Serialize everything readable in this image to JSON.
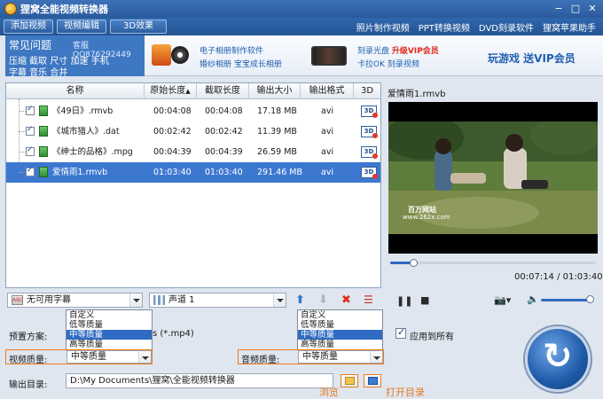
{
  "app": {
    "title": "狸窝全能视频转换器",
    "window_buttons": [
      "−",
      "□",
      "✕"
    ]
  },
  "toolbar": {
    "add_video": "添加视频",
    "edit_video": "视频编辑",
    "effect_3d": "3D效果",
    "links": [
      "照片制作视频",
      "PPT转换视频",
      "DVD刻录软件",
      "狸窝苹果助手"
    ]
  },
  "faq": {
    "heading": "常见问题",
    "qq": "客服QQ876292449",
    "row1": "压缩  截取  尺寸  加速  手机",
    "row2": "字幕  音乐  合并"
  },
  "promo": {
    "album_line1": "电子相册制作软件",
    "album_line2": "婚纱相册  宝宝成长相册",
    "burn_line1": "刻录光盘",
    "burn_vip": "升级VIP会员",
    "burn_line2": "卡拉OK  刻录视频",
    "game": "玩游戏  送VIP会员"
  },
  "table": {
    "headers": [
      "名称",
      "原始长度",
      "截取长度",
      "输出大小",
      "输出格式",
      "3D"
    ],
    "rows": [
      {
        "name": "《49日》.rmvb",
        "orig": "00:04:08",
        "cut": "00:04:08",
        "size": "17.18 MB",
        "fmt": "avi",
        "badge": "3D"
      },
      {
        "name": "《城市猎人》.dat",
        "orig": "00:02:42",
        "cut": "00:02:42",
        "size": "11.39 MB",
        "fmt": "avi",
        "badge": "3D"
      },
      {
        "name": "《绅士的品格》.mpg",
        "orig": "00:04:39",
        "cut": "00:04:39",
        "size": "26.59 MB",
        "fmt": "avi",
        "badge": "3D"
      },
      {
        "name": "爱情雨1.rmvb",
        "orig": "01:03:40",
        "cut": "01:03:40",
        "size": "291.46 MB",
        "fmt": "avi",
        "badge": "3D"
      }
    ]
  },
  "preview": {
    "filename": "爱情雨1.rmvb",
    "time": "00:07:14 / 01:03:40",
    "progress": 0.114,
    "watermark": "百万网站",
    "watermark_url": "www.262x.com"
  },
  "controls": {
    "subtitle": "无可用字幕",
    "audio_track": "声道 1"
  },
  "settings": {
    "preset_label": "预置方案:",
    "preset_value": "s (*.mp4)",
    "video_quality_label": "视频质量:",
    "video_quality_value": "中等质量",
    "audio_quality_label": "音频质量:",
    "audio_quality_value": "中等质量",
    "apply_all": "应用到所有",
    "output_label": "输出目录:",
    "output_path": "D:\\My Documents\\狸窝\\全能视频转换器",
    "video_options": [
      "自定义",
      "低等质量",
      "中等质量",
      "高等质量"
    ],
    "audio_options": [
      "自定义",
      "低等质量",
      "中等质量",
      "高等质量"
    ],
    "selected_option": "中等质量",
    "browse_annot": "浏览",
    "open_annot": "打开目录"
  }
}
